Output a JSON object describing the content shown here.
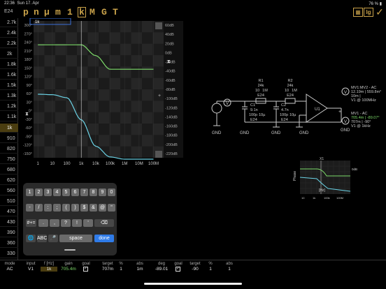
{
  "status": {
    "time": "22:36",
    "date": "Sun 17. Apr",
    "battery": "76 %"
  },
  "toolbar": {
    "e24": "E24",
    "prefixes": [
      "p",
      "n",
      "µ",
      "m",
      "1",
      "k",
      "M",
      "G",
      "T"
    ],
    "selected_prefix": "k",
    "lg_label": "lg",
    "check": "✓"
  },
  "values": [
    "2.7k",
    "2.4k",
    "2.2k",
    "2k",
    "1.8k",
    "1.6k",
    "1.5k",
    "1.3k",
    "1.2k",
    "1.1k",
    "1k",
    "910",
    "820",
    "750",
    "680",
    "620",
    "560",
    "510",
    "470",
    "430",
    "390",
    "360",
    "330"
  ],
  "selected_value": "1k",
  "chart": {
    "cursor_label": "1k",
    "y_left": [
      "300°",
      "270°",
      "240°",
      "210°",
      "180°",
      "150°",
      "120°",
      "90°",
      "60°",
      "30°",
      "0°",
      "-30°",
      "-60°",
      "-90°",
      "-120°",
      "-150°"
    ],
    "y_right": [
      "60dB",
      "40dB",
      "20dB",
      "0dB",
      "-20dB",
      "-40dB",
      "-60dB",
      "-80dB",
      "-100dB",
      "-120dB",
      "-140dB",
      "-160dB",
      "-180dB",
      "-200dB",
      "-220dB"
    ],
    "x_ticks": [
      "1",
      "10",
      "100",
      "1k",
      "10k",
      "100k",
      "1M",
      "10M",
      "100M"
    ],
    "colors": {
      "gain": "#7ddb6a",
      "phase": "#6bd3e6",
      "cursor": "#3a6fd8"
    }
  },
  "chart_data": {
    "type": "line",
    "xlabel": "",
    "ylabel": "",
    "x_scale": "log",
    "x": [
      1,
      10,
      100,
      1000,
      10000,
      100000,
      1000000,
      10000000,
      100000000
    ],
    "series": [
      {
        "values_db": [
          -3,
          -3,
          -3,
          -3,
          -14,
          -28,
          -28,
          -28,
          -28
        ]
      },
      {
        "values_deg": [
          -30,
          -31,
          -38,
          -89,
          -150,
          -175,
          -180,
          -180,
          -180
        ]
      }
    ]
  },
  "schematic": {
    "r1": [
      "R1",
      "24k",
      "10",
      "1M",
      "E24"
    ],
    "r2": [
      "R2",
      "24k",
      "10",
      "1M",
      "E24"
    ],
    "c1": [
      "C1",
      "9.1n",
      "100p",
      "10µ",
      "E24"
    ],
    "c2": [
      "C2",
      "4.7n",
      "100p",
      "10µ",
      "E24"
    ],
    "u1": "U1",
    "gnd": "GND",
    "v": "V",
    "mv12": [
      "MV1:MV2 - AC",
      "12.19m | 559.8m°",
      "10m |",
      "V1 @ 100MHz"
    ],
    "mv1": [
      "MV1 - AC",
      "705.4m | -89.07°",
      "707m | -90°",
      "V1 @ 1kHz"
    ]
  },
  "mini": {
    "phase": "Phase",
    "x1": "X1",
    "hz": "[Hz]",
    "db": "0dB"
  },
  "keyboard": {
    "row1": [
      "1",
      "2",
      "3",
      "4",
      "5",
      "6",
      "7",
      "8",
      "9",
      "0"
    ],
    "row2": [
      "-",
      "/",
      ":",
      ";",
      "(",
      ")",
      "$",
      "&",
      "@",
      "\""
    ],
    "row3": [
      "#+=",
      ".",
      ",",
      "?",
      "!",
      "'",
      "⌫"
    ],
    "row4": [
      "🌐",
      "ABC",
      "🎤",
      "space",
      "done"
    ]
  },
  "bottom": {
    "headers": [
      "mode",
      "input",
      "f [Hz]",
      "gain",
      "goal",
      "target",
      "%",
      "abs",
      "deg",
      "goal",
      "target",
      "%",
      "abs"
    ],
    "row": [
      "AC",
      "V1",
      "1k",
      "705.4m",
      "✓",
      "707m",
      "1",
      "1m",
      "-89.01",
      "✓",
      "-90",
      "1",
      "1"
    ]
  }
}
